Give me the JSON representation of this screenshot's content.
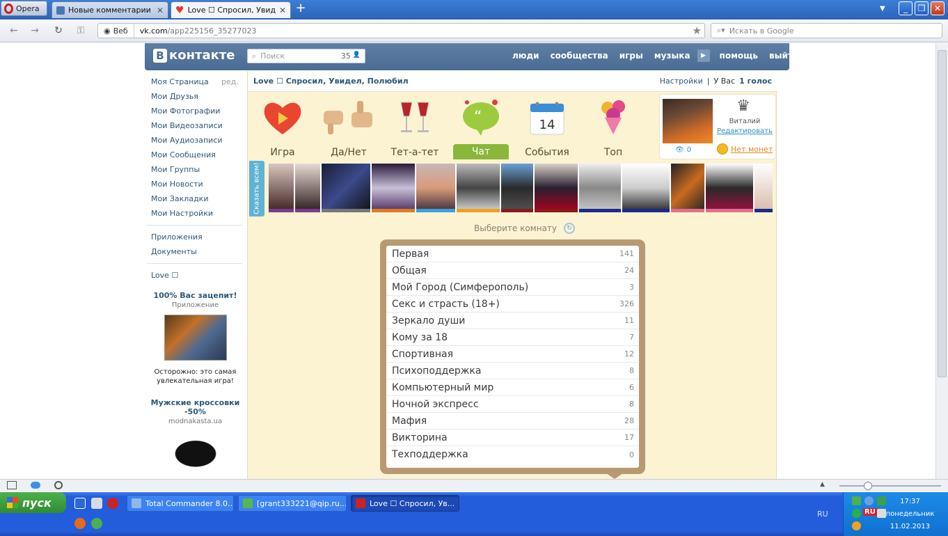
{
  "browser": {
    "menu_label": "Opera",
    "tabs": [
      {
        "title": "Новые комментарии",
        "close": "✕"
      },
      {
        "title": "Love ☐ Спросил, Увид...",
        "close": "✕"
      }
    ],
    "new_tab": "+",
    "tab_menu": "▼",
    "window_buttons": {
      "min": "_",
      "max": "❐",
      "close": "✕"
    },
    "nav": {
      "back": "←",
      "forward": "→",
      "reload": "↻",
      "key": "⚿"
    },
    "address": {
      "badge": "Веб",
      "url_host": "vk.com",
      "url_path": "/app225156_35277023"
    },
    "search_placeholder": "Искать в Google"
  },
  "vk": {
    "logo_letter": "В",
    "logo_text": "контакте",
    "search": {
      "placeholder": "Поиск",
      "count": "35",
      "person_icon": "👤"
    },
    "menu": [
      "люди",
      "сообщества",
      "игры",
      "музыка",
      "помощь",
      "выйти"
    ],
    "play_icon": "▶",
    "left_menu": [
      "Моя Страница",
      "Мои Друзья",
      "Мои Фотографии",
      "Мои Видеозаписи",
      "Мои Аудиозаписи",
      "Мои Сообщения",
      "Мои Группы",
      "Мои Новости",
      "Мои Закладки",
      "Мои Настройки"
    ],
    "edit_label": "ред.",
    "left_menu2": [
      "Приложения",
      "Документы"
    ],
    "left_menu3": [
      "Love ☐"
    ],
    "ad1": {
      "title": "100% Вас зацепит!",
      "subtitle": "Приложение",
      "text": "Осторожно: это самая увлекательная игра!"
    },
    "ad2": {
      "title": "Мужские кроссовки -50%",
      "subtitle": "modnakasta.ua"
    }
  },
  "app": {
    "title": "Love ☐ Спросил, Увидел, Полюбил",
    "settings": "Настройки",
    "sep": "|",
    "votes_prefix": "У Вас",
    "votes_value": "1 голос",
    "nav": [
      {
        "label": "Игра",
        "icon": "heart-play-icon"
      },
      {
        "label": "Да/Нет",
        "icon": "thumbs-icon"
      },
      {
        "label": "Тет-а-тет",
        "icon": "wine-glasses-icon"
      },
      {
        "label": "Чат",
        "icon": "chat-bubble-icon"
      },
      {
        "label": "События",
        "icon": "calendar-icon",
        "day": "14"
      },
      {
        "label": "Топ",
        "icon": "bouquet-icon"
      }
    ],
    "profile": {
      "crown": "♛",
      "name": "Виталий",
      "edit": "Редактировать",
      "eye": "👁",
      "views": "0",
      "coins": "Нет монет"
    },
    "shout": "Сказать всем!",
    "photos": [
      {
        "bar": "#7c3b8f",
        "bg": "linear-gradient(#d9c6c0,#3b2020)"
      },
      {
        "bar": "#7c3b8f",
        "bg": "linear-gradient(#e7d9d3,#2a1a1a)"
      },
      {
        "bar": "#777777",
        "bg": "linear-gradient(135deg,#1a1e3a,#3b4a8a,#111)"
      },
      {
        "bar": "#e07b20",
        "bg": "linear-gradient(#2a1a3a,#c8c0d8,#4a2a5a)"
      },
      {
        "bar": "#3aa0e0",
        "bg": "linear-gradient(#c8b8b8,#d89a78,#3a2a3a)"
      },
      {
        "bar": "#f0a020",
        "bg": "linear-gradient(#bbb,#444,#ddd)"
      },
      {
        "bar": "#8a1a1a",
        "bg": "linear-gradient(#6aa0d8,#2a2a2a,#555)"
      },
      {
        "bar": "#8a1a1a",
        "bg": "linear-gradient(#d8d0c8,#2a2030,#b00020)"
      },
      {
        "bar": "#1a2a8a",
        "bg": "linear-gradient(#eee,#888,#ccc)"
      },
      {
        "bar": "#1a2a8a",
        "bg": "linear-gradient(#fff,#ccc,#222)"
      },
      {
        "bar": "#e07090",
        "bg": "linear-gradient(135deg,#222,#c86a20,#222)"
      },
      {
        "bar": "#e07090",
        "bg": "linear-gradient(#fff,#2a2a2a,#a01040)"
      },
      {
        "bar": "#1a2a8a",
        "bg": "linear-gradient(#fff,#d8b8a8)"
      }
    ],
    "choose_room": "Выберите комнату",
    "refresh_icon": "↻",
    "rooms": [
      {
        "name": "Первая",
        "count": "141"
      },
      {
        "name": "Общая",
        "count": "24"
      },
      {
        "name": "Мой Город (Симферополь)",
        "count": "3"
      },
      {
        "name": "Секс и страсть (18+)",
        "count": "326"
      },
      {
        "name": "Зеркало души",
        "count": "11"
      },
      {
        "name": "Кому за 18",
        "count": "7"
      },
      {
        "name": "Спортивная",
        "count": "12"
      },
      {
        "name": "Психоподдержка",
        "count": "8"
      },
      {
        "name": "Компьютерный мир",
        "count": "6"
      },
      {
        "name": "Ночной экспресс",
        "count": "8"
      },
      {
        "name": "Мафия",
        "count": "28"
      },
      {
        "name": "Викторина",
        "count": "17"
      },
      {
        "name": "Техподдержка",
        "count": "0"
      }
    ]
  },
  "taskbar": {
    "start": "пуск",
    "buttons": [
      {
        "title": "Total Commander 8.0...",
        "icon_color": "#8fb7e8"
      },
      {
        "title": "[grant333221@qip.ru...",
        "icon_color": "#57b84a"
      },
      {
        "title": "Love ☐ Спросил, Ув...",
        "icon_color": "#d02020"
      }
    ],
    "lang": "RU",
    "tray_lang": "RU",
    "clock": {
      "time": "17:37",
      "day": "понедельник",
      "date": "11.02.2013"
    }
  }
}
